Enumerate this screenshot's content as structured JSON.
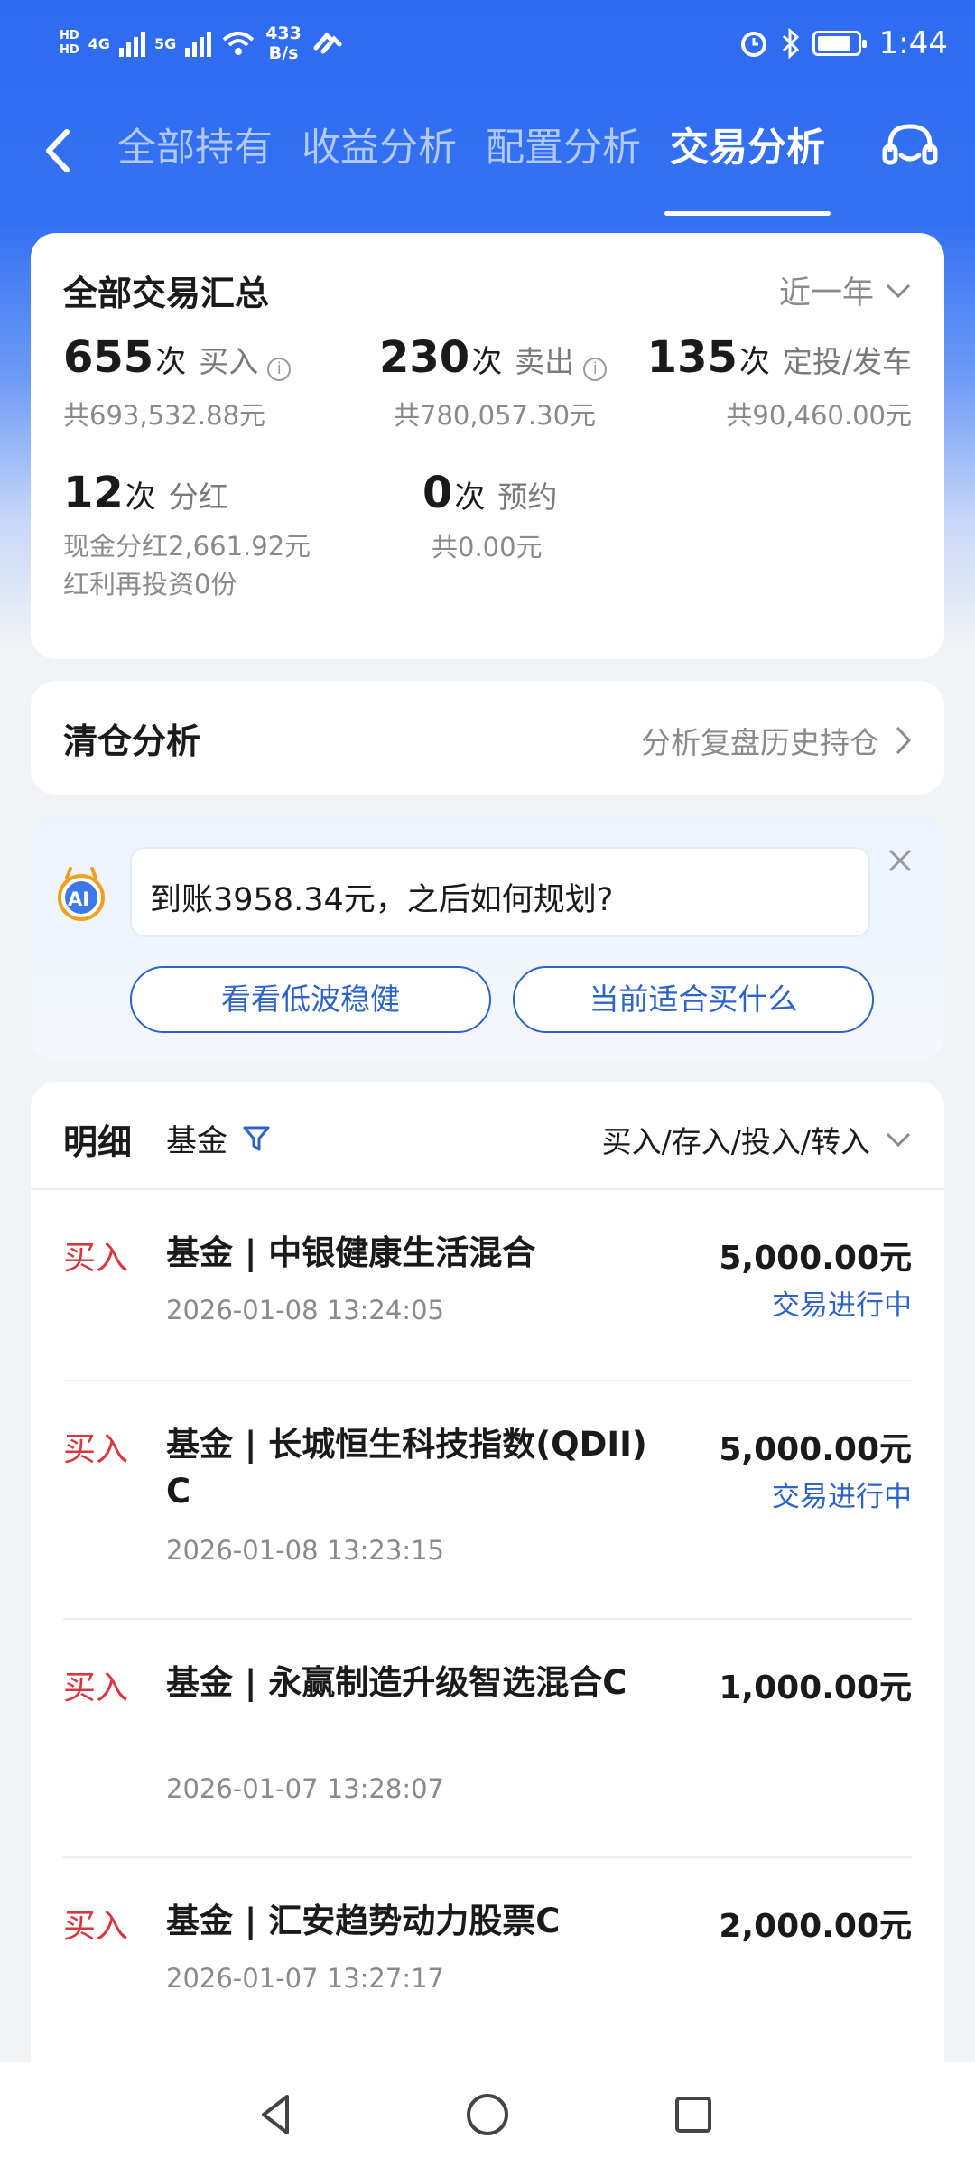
{
  "status_bar": {
    "network_hd_top": "HD",
    "network_hd_bottom": "HD",
    "net1": "4G",
    "net2": "5G",
    "speed_value": "433",
    "speed_unit": "B/s",
    "time": "1:44"
  },
  "nav": {
    "tabs": [
      "全部持有",
      "收益分析",
      "配置分析",
      "交易分析"
    ],
    "active_tab": "交易分析"
  },
  "summary": {
    "title": "全部交易汇总",
    "period": "近一年",
    "buy": {
      "count": "655",
      "unit": "次",
      "label": "买入",
      "sub": "共693,532.88元"
    },
    "sell": {
      "count": "230",
      "unit": "次",
      "label": "卖出",
      "sub": "共780,057.30元"
    },
    "regular": {
      "count": "135",
      "unit": "次",
      "label": "定投/发车",
      "sub": "共90,460.00元"
    },
    "dividend": {
      "count": "12",
      "unit": "次",
      "label": "分红",
      "sub1": "现金分红2,661.92元",
      "sub2": "红利再投资0份"
    },
    "reserve": {
      "count": "0",
      "unit": "次",
      "label": "预约",
      "sub": "共0.00元"
    }
  },
  "clear_analysis": {
    "title": "清仓分析",
    "link": "分析复盘历史持仓"
  },
  "ai_card": {
    "avatar_text": "AI",
    "message": "到账3958.34元，之后如何规划?",
    "buttons": [
      "看看低波稳健",
      "当前适合买什么"
    ]
  },
  "detail": {
    "title": "明细",
    "fund_filter": "基金",
    "type_filter": "买入/存入/投入/转入",
    "rows": [
      {
        "type": "买入",
        "name": "基金 | 中银健康生活混合",
        "time": "2026-01-08 13:24:05",
        "amount": "5,000.00元",
        "status": "交易进行中"
      },
      {
        "type": "买入",
        "name": "基金 | 长城恒生科技指数(QDII)C",
        "time": "2026-01-08 13:23:15",
        "amount": "5,000.00元",
        "status": "交易进行中"
      },
      {
        "type": "买入",
        "name": "基金 | 永赢制造升级智选混合C",
        "time": "2026-01-07 13:28:07",
        "amount": "1,000.00元",
        "status": ""
      },
      {
        "type": "买入",
        "name": "基金 | 汇安趋势动力股票C",
        "time": "2026-01-07 13:27:17",
        "amount": "2,000.00元",
        "status": ""
      }
    ]
  }
}
